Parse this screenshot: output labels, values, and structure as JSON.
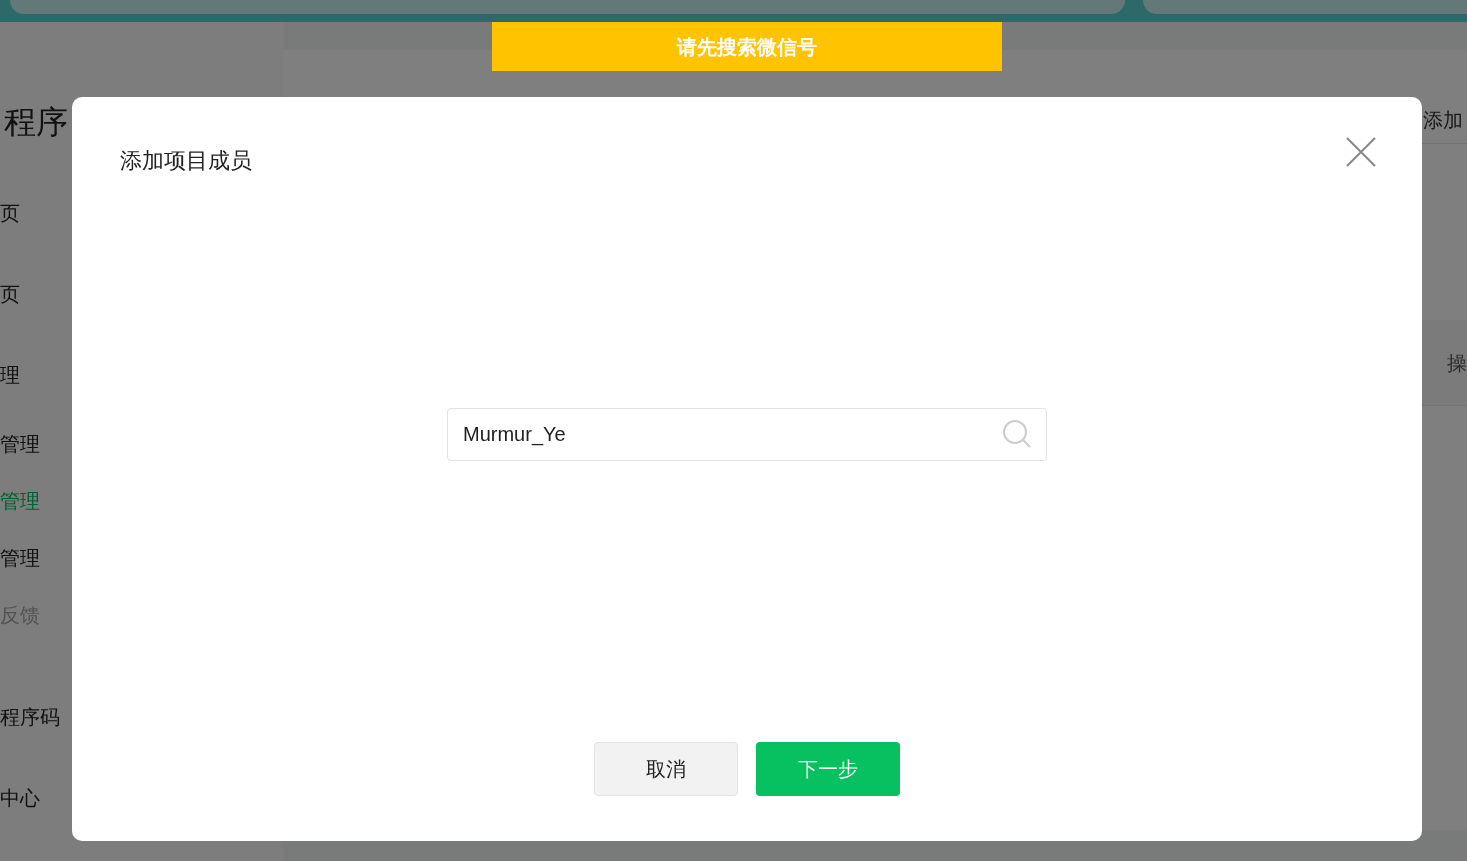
{
  "toast": {
    "text": "请先搜索微信号"
  },
  "sidebar": {
    "title": "程序",
    "items": [
      {
        "label": "页",
        "selected": false,
        "disabled": false
      },
      {
        "label": "页",
        "selected": false,
        "disabled": false
      },
      {
        "label": "理",
        "selected": false,
        "disabled": false,
        "children": [
          {
            "label": "管理",
            "selected": false,
            "disabled": false
          },
          {
            "label": "管理",
            "selected": true,
            "disabled": false
          },
          {
            "label": "管理",
            "selected": false,
            "disabled": false
          },
          {
            "label": "反馈",
            "selected": false,
            "disabled": true
          }
        ]
      },
      {
        "label": "程序码",
        "selected": false,
        "disabled": false
      },
      {
        "label": "中心",
        "selected": false,
        "disabled": false
      }
    ]
  },
  "main": {
    "add_button": "添加",
    "table": {
      "columns": [
        "操"
      ]
    }
  },
  "dialog": {
    "title": "添加项目成员",
    "search": {
      "value": "Murmur_Ye"
    },
    "buttons": [
      {
        "label": "取消",
        "kind": "secondary"
      },
      {
        "label": "下一步",
        "kind": "primary"
      }
    ]
  }
}
